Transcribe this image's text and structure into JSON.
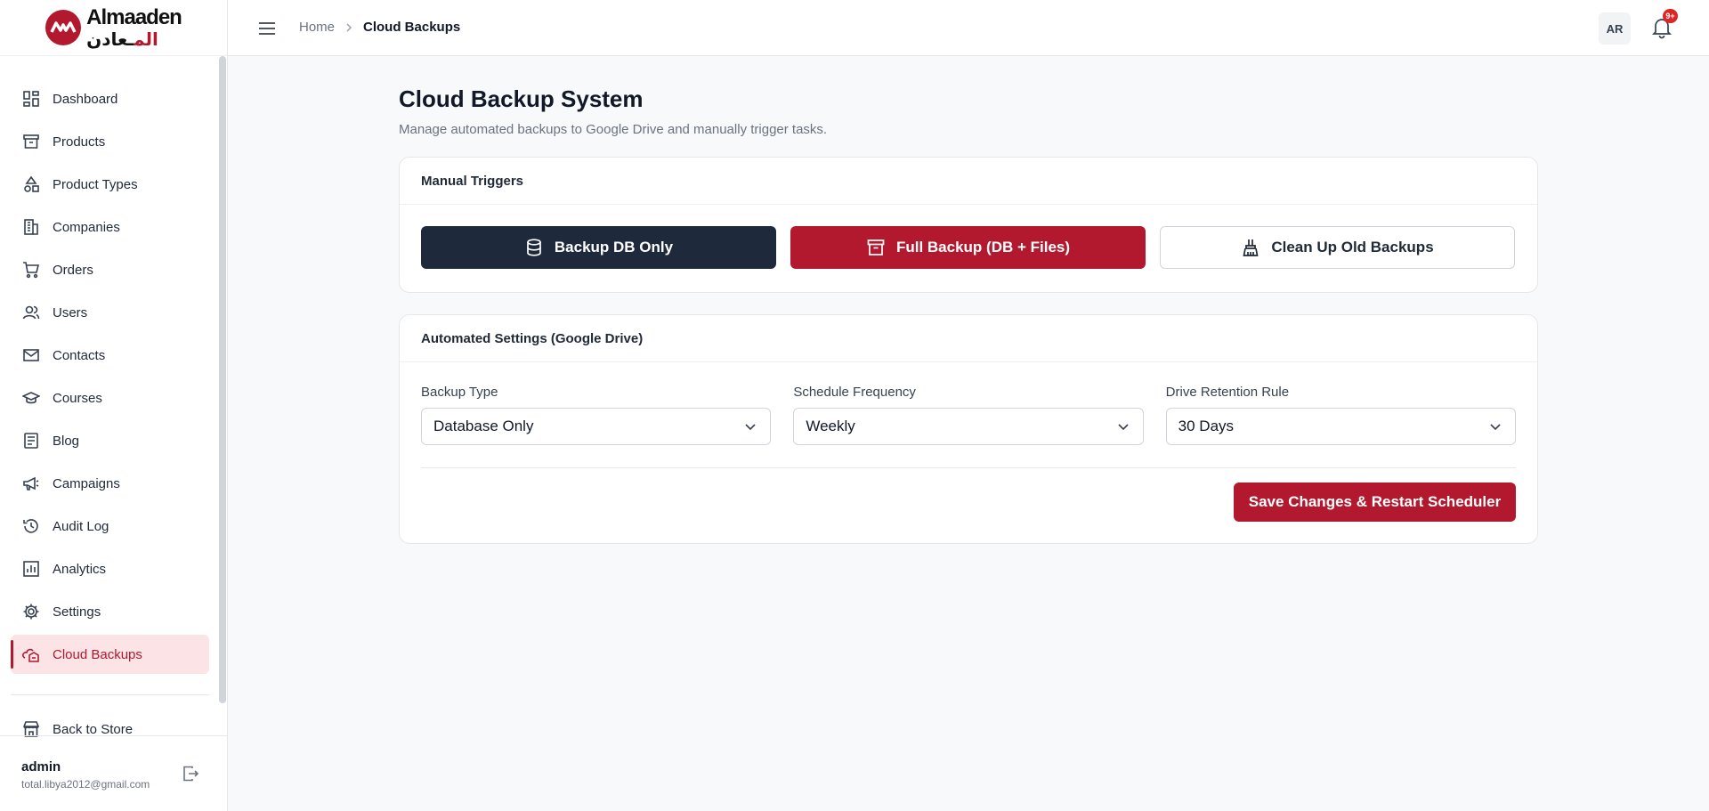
{
  "brand": {
    "name_en": "Almaaden",
    "name_ar_red": "الم",
    "name_ar_rest": "ـعادن",
    "accent_color": "#b3192e"
  },
  "sidebar": {
    "items": [
      {
        "label": "Dashboard",
        "icon": "dashboard-icon"
      },
      {
        "label": "Products",
        "icon": "archive-icon"
      },
      {
        "label": "Product Types",
        "icon": "shapes-icon"
      },
      {
        "label": "Companies",
        "icon": "building-icon"
      },
      {
        "label": "Orders",
        "icon": "cart-icon"
      },
      {
        "label": "Users",
        "icon": "users-icon"
      },
      {
        "label": "Contacts",
        "icon": "mail-icon"
      },
      {
        "label": "Courses",
        "icon": "graduation-cap-icon"
      },
      {
        "label": "Blog",
        "icon": "document-icon"
      },
      {
        "label": "Campaigns",
        "icon": "megaphone-icon"
      },
      {
        "label": "Audit Log",
        "icon": "history-icon"
      },
      {
        "label": "Analytics",
        "icon": "bar-chart-icon"
      },
      {
        "label": "Settings",
        "icon": "gear-icon"
      },
      {
        "label": "Cloud Backups",
        "icon": "cloud-backup-icon"
      }
    ],
    "active": "Cloud Backups",
    "back_to_store": "Back to Store",
    "user": {
      "name": "admin",
      "email": "total.libya2012@gmail.com"
    }
  },
  "topbar": {
    "breadcrumb_home": "Home",
    "breadcrumb_current": "Cloud Backups",
    "lang_label": "AR",
    "notification_badge": "9+"
  },
  "main": {
    "title": "Cloud Backup System",
    "subtitle": "Manage automated backups to Google Drive and manually trigger tasks.",
    "manual": {
      "heading": "Manual Triggers",
      "backup_db": "Backup DB Only",
      "full_backup": "Full Backup (DB + Files)",
      "cleanup": "Clean Up Old Backups"
    },
    "automated": {
      "heading": "Automated Settings (Google Drive)",
      "backup_type_label": "Backup Type",
      "backup_type_value": "Database Only",
      "frequency_label": "Schedule Frequency",
      "frequency_value": "Weekly",
      "retention_label": "Drive Retention Rule",
      "retention_value": "30 Days",
      "save_label": "Save Changes & Restart Scheduler"
    }
  }
}
